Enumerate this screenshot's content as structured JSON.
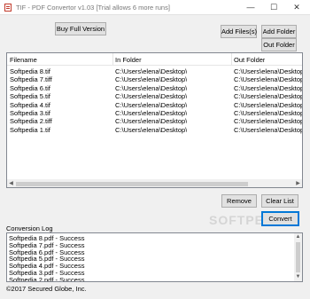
{
  "window": {
    "title": "TIF - PDF Convertor v1.03 [Trial allows 6 more runs]",
    "minimize_glyph": "—",
    "maximize_glyph": "☐",
    "close_glyph": "✕"
  },
  "toolbar": {
    "buy_label": "Buy Full Version",
    "add_files_label": "Add Files(s)",
    "add_folder_label": "Add Folder",
    "out_folder_label": "Out Folder"
  },
  "file_list": {
    "columns": [
      "Filename",
      "In Folder",
      "Out Folder"
    ],
    "rows": [
      [
        "Softpedia 8.tif",
        "C:\\Users\\elena\\Desktop\\",
        "C:\\Users\\elena\\Desktop\\"
      ],
      [
        "Softpedia 7.tiff",
        "C:\\Users\\elena\\Desktop\\",
        "C:\\Users\\elena\\Desktop\\"
      ],
      [
        "Softpedia 6.tif",
        "C:\\Users\\elena\\Desktop\\",
        "C:\\Users\\elena\\Desktop\\"
      ],
      [
        "Softpedia 5.tif",
        "C:\\Users\\elena\\Desktop\\",
        "C:\\Users\\elena\\Desktop\\"
      ],
      [
        "Softpedia 4.tif",
        "C:\\Users\\elena\\Desktop\\",
        "C:\\Users\\elena\\Desktop\\"
      ],
      [
        "Softpedia 3.tif",
        "C:\\Users\\elena\\Desktop\\",
        "C:\\Users\\elena\\Desktop\\"
      ],
      [
        "Softpedia 2.tiff",
        "C:\\Users\\elena\\Desktop\\",
        "C:\\Users\\elena\\Desktop\\"
      ],
      [
        "Softpedia 1.tif",
        "C:\\Users\\elena\\Desktop\\",
        "C:\\Users\\elena\\Desktop\\"
      ]
    ]
  },
  "actions": {
    "remove_label": "Remove",
    "clear_label": "Clear List",
    "convert_label": "Convert"
  },
  "log": {
    "label": "Conversion Log",
    "lines": [
      "Softpedia 8.pdf - Success",
      "Softpedia 7.pdf - Success",
      "Softpedia 6.pdf - Success",
      "Softpedia 5.pdf - Success",
      "Softpedia 4.pdf - Success",
      "Softpedia 3.pdf - Success",
      "Softpedia 2.pdf - Success"
    ]
  },
  "footer": {
    "copyright": "©2017 Secured Globe, Inc."
  },
  "watermark": "SOFTPEDIA",
  "icons": [
    "app-icon",
    "minimize-icon",
    "maximize-icon",
    "close-icon",
    "scroll-left-icon",
    "scroll-right-icon",
    "scroll-up-icon",
    "scroll-down-icon"
  ],
  "colors": {
    "accent": "#0078d7",
    "background": "#f0f0f0",
    "list_border": "#828790"
  }
}
